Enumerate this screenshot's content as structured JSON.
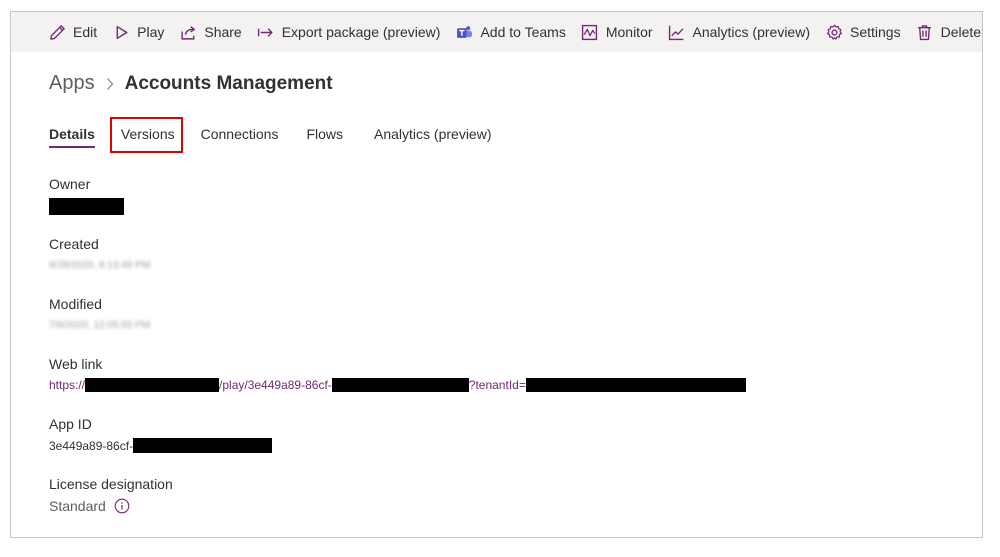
{
  "toolbar": {
    "items": [
      {
        "label": "Edit",
        "icon": "pencil-icon"
      },
      {
        "label": "Play",
        "icon": "play-icon"
      },
      {
        "label": "Share",
        "icon": "share-icon"
      },
      {
        "label": "Export package (preview)",
        "icon": "export-arrow-icon"
      },
      {
        "label": "Add to Teams",
        "icon": "teams-icon"
      },
      {
        "label": "Monitor",
        "icon": "monitor-icon"
      },
      {
        "label": "Analytics (preview)",
        "icon": "analytics-icon"
      },
      {
        "label": "Settings",
        "icon": "gear-icon"
      },
      {
        "label": "Delete",
        "icon": "trash-icon"
      }
    ]
  },
  "breadcrumb": {
    "root": "Apps",
    "separator_icon": "chevron-right-icon",
    "current": "Accounts Management"
  },
  "tabs": [
    {
      "label": "Details",
      "active": true
    },
    {
      "label": "Versions",
      "active": false,
      "highlighted": true
    },
    {
      "label": "Connections",
      "active": false
    },
    {
      "label": "Flows",
      "active": false
    },
    {
      "label": "Analytics (preview)",
      "active": false
    }
  ],
  "details": {
    "owner": {
      "label": "Owner",
      "value": "[redacted]"
    },
    "created": {
      "label": "Created",
      "value": "6/28/2020, 8:13:49 PM"
    },
    "modified": {
      "label": "Modified",
      "value": "7/6/2020, 12:05:55 PM"
    },
    "web_link": {
      "label": "Web link",
      "part1": "https://",
      "part2": "/play/3e449a89-86cf-",
      "part3": "?tenantId="
    },
    "app_id": {
      "label": "App ID",
      "value_prefix": "3e449a89-86cf-"
    },
    "license": {
      "label": "License designation",
      "value": "Standard",
      "info_icon": "info-icon"
    }
  },
  "colors": {
    "accent": "#742774",
    "highlight_box": "#e00000",
    "toolbar_bg": "#f3f2f1"
  }
}
